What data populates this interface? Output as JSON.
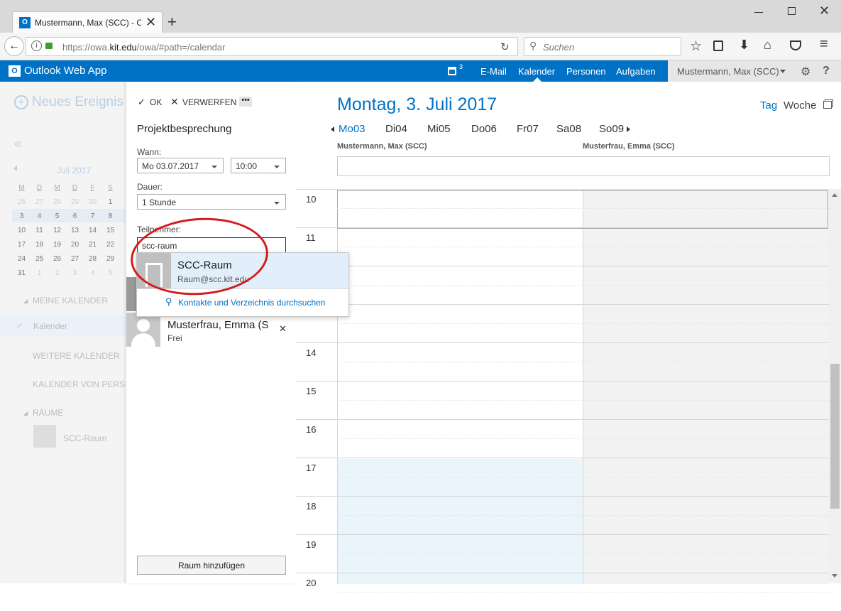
{
  "browser": {
    "tab_title": "Mustermann, Max (SCC) - O",
    "url_pre": "https://owa.",
    "url_host": "kit.edu",
    "url_post": "/owa/#path=/calendar",
    "search_placeholder": "Suchen"
  },
  "owa": {
    "app_name": "Outlook Web App",
    "badge": "3",
    "nav": [
      "E-Mail",
      "Kalender",
      "Personen",
      "Aufgaben"
    ],
    "user": "Mustermann, Max (SCC)"
  },
  "left": {
    "new_event": "Neues Ereignis",
    "month": "Juli 2017",
    "weekdays": [
      "M",
      "D",
      "M",
      "D",
      "F",
      "S"
    ],
    "weeks": [
      [
        "26",
        "27",
        "28",
        "29",
        "30",
        "1"
      ],
      [
        "3",
        "4",
        "5",
        "6",
        "7",
        "8"
      ],
      [
        "10",
        "11",
        "12",
        "13",
        "14",
        "15"
      ],
      [
        "17",
        "18",
        "19",
        "20",
        "21",
        "22"
      ],
      [
        "24",
        "25",
        "26",
        "27",
        "28",
        "29"
      ],
      [
        "31",
        "1",
        "2",
        "3",
        "4",
        "5"
      ]
    ],
    "my_calendars": "MEINE KALENDER",
    "calendar": "Kalender",
    "more_calendars": "WEITERE KALENDER",
    "people_calendars": "KALENDER VON PERSON",
    "rooms": "RÄUME",
    "room_item": "SCC-Raum"
  },
  "form": {
    "ok": "OK",
    "discard": "VERWERFEN",
    "title": "Projektbesprechung",
    "when_label": "Wann:",
    "date": "Mo 03.07.2017",
    "time": "10:00",
    "duration_label": "Dauer:",
    "duration": "1 Stunde",
    "attendees_label": "Teilnehmer:",
    "attendee_input": "scc-raum",
    "attendee_name": "Musterfrau, Emma (S",
    "attendee_status": "Frei",
    "add_room": "Raum hinzufügen"
  },
  "popup": {
    "name": "SCC-Raum",
    "email": "Raum@scc.kit.edu",
    "search": "Kontakte und Verzeichnis durchsuchen"
  },
  "calendar": {
    "date_title": "Montag, 3. Juli 2017",
    "view_day": "Tag",
    "view_week": "Woche",
    "days": [
      "Mo03",
      "Di04",
      "Mi05",
      "Do06",
      "Fr07",
      "Sa08",
      "So09"
    ],
    "col1": "Mustermann, Max (SCC)",
    "col2": "Musterfrau, Emma (SCC)",
    "hours": [
      "10",
      "11",
      "",
      "",
      "14",
      "15",
      "16",
      "17",
      "18",
      "19",
      "20"
    ]
  }
}
